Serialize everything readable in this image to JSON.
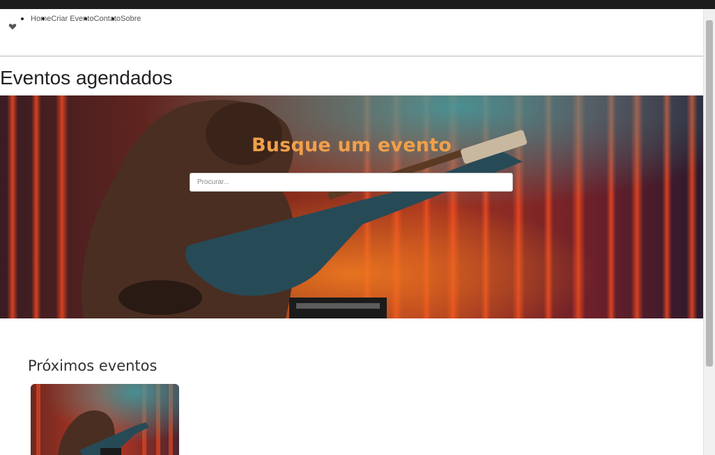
{
  "nav": {
    "logo_icon": "heart-icon",
    "items": [
      {
        "label": "Home"
      },
      {
        "label": "Criar Evento"
      },
      {
        "label": "Contato"
      },
      {
        "label": "Sobre"
      }
    ]
  },
  "page": {
    "title": "Eventos agendados"
  },
  "hero": {
    "title": "Busque um evento",
    "search_placeholder": "Procurar..."
  },
  "upcoming": {
    "title": "Próximos eventos",
    "cards": [
      {
        "image": "gorilla-guitar-image"
      }
    ]
  },
  "colors": {
    "hero_title": "#f0a04a",
    "curtain_red": "#c8281e",
    "curtain_orange": "#e2691d",
    "teal_light": "#2f7f8a"
  }
}
